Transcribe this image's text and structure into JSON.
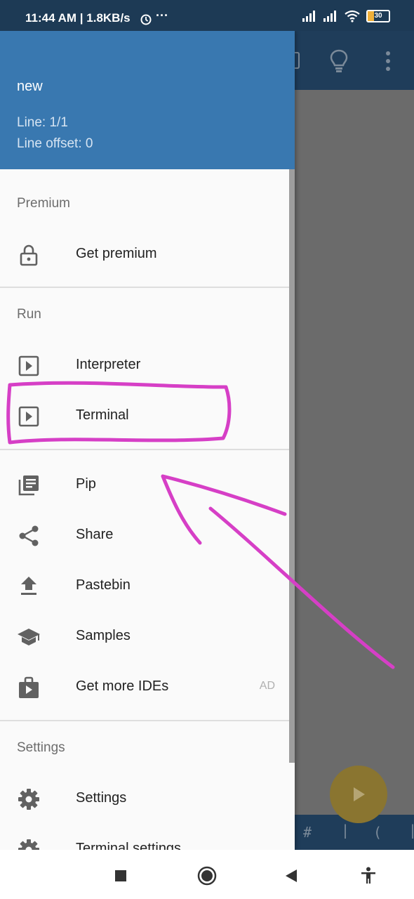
{
  "status_bar": {
    "time": "11:44 AM | 1.8KB/s",
    "battery": "30"
  },
  "drawer": {
    "header": {
      "file_name": "new",
      "line": "Line: 1/1",
      "line_offset": "Line offset: 0"
    },
    "sections": {
      "premium": "Premium",
      "run": "Run",
      "settings": "Settings"
    },
    "items": {
      "get_premium": {
        "label": "Get premium",
        "icon": "lock-icon"
      },
      "interpreter": {
        "label": "Interpreter",
        "icon": "play-box-icon"
      },
      "terminal": {
        "label": "Terminal",
        "icon": "play-box-icon"
      },
      "pip": {
        "label": "Pip",
        "icon": "library-icon"
      },
      "share": {
        "label": "Share",
        "icon": "share-icon"
      },
      "pastebin": {
        "label": "Pastebin",
        "icon": "upload-icon"
      },
      "samples": {
        "label": "Samples",
        "icon": "school-icon"
      },
      "get_more_ides": {
        "label": "Get more IDEs",
        "badge": "AD",
        "icon": "store-play-icon"
      },
      "settings": {
        "label": "Settings",
        "icon": "gear-icon"
      },
      "terminal_settings": {
        "label": "Terminal settings",
        "icon": "gear-icon"
      }
    }
  },
  "app": {
    "keybar": [
      "#",
      "("
    ]
  },
  "colors": {
    "header": "#3978b0",
    "toolbar": "#1f3d5a",
    "annotation": "#d63fc6"
  }
}
